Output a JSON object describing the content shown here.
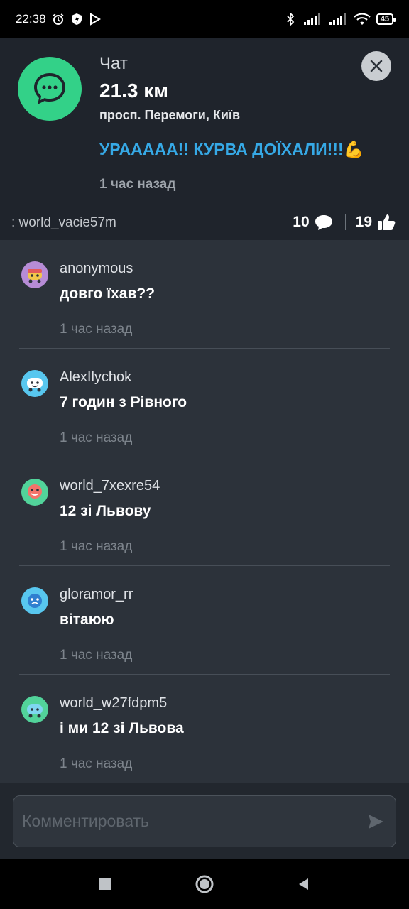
{
  "status_bar": {
    "time": "22:38",
    "battery": "45",
    "icons": [
      "alarm-icon",
      "shield-icon",
      "play-icon",
      "bluetooth-icon",
      "signal-icon",
      "signal-icon",
      "wifi-icon",
      "battery-icon"
    ]
  },
  "header": {
    "title": "Чат",
    "distance": "21.3 км",
    "address": "просп. Перемоги, Київ",
    "message": "УРААААА!! КУРВА ДОЇХАЛИ!!!💪",
    "time": "1 час назад",
    "user": ": world_vacie57m",
    "comments_count": "10",
    "likes_count": "19",
    "accent_color": "#33d188",
    "message_color": "#36a9e6"
  },
  "comments": [
    {
      "user": "anonymous",
      "text": " довго їхав??",
      "time": "1 час назад",
      "avatar_color": "#b78cd6"
    },
    {
      "user": "AlexIlychok",
      "text": "7 годин з Рівного",
      "time": "1 час назад",
      "avatar_color": "#58c7ef"
    },
    {
      "user": "world_7xexre54",
      "text": "12  зі Львову",
      "time": "1 час назад",
      "avatar_color": "#52d39a"
    },
    {
      "user": "gloramor_rr",
      "text": "вітаюю",
      "time": "1 час назад",
      "avatar_color": "#58c7ef"
    },
    {
      "user": "world_w27fdpm5",
      "text": "і ми 12 зі Львова",
      "time": "1 час назад",
      "avatar_color": "#52d39a"
    }
  ],
  "input": {
    "placeholder": "Комментировать",
    "value": ""
  },
  "nav": {
    "icons": [
      "recents-icon",
      "home-icon",
      "back-icon"
    ]
  }
}
